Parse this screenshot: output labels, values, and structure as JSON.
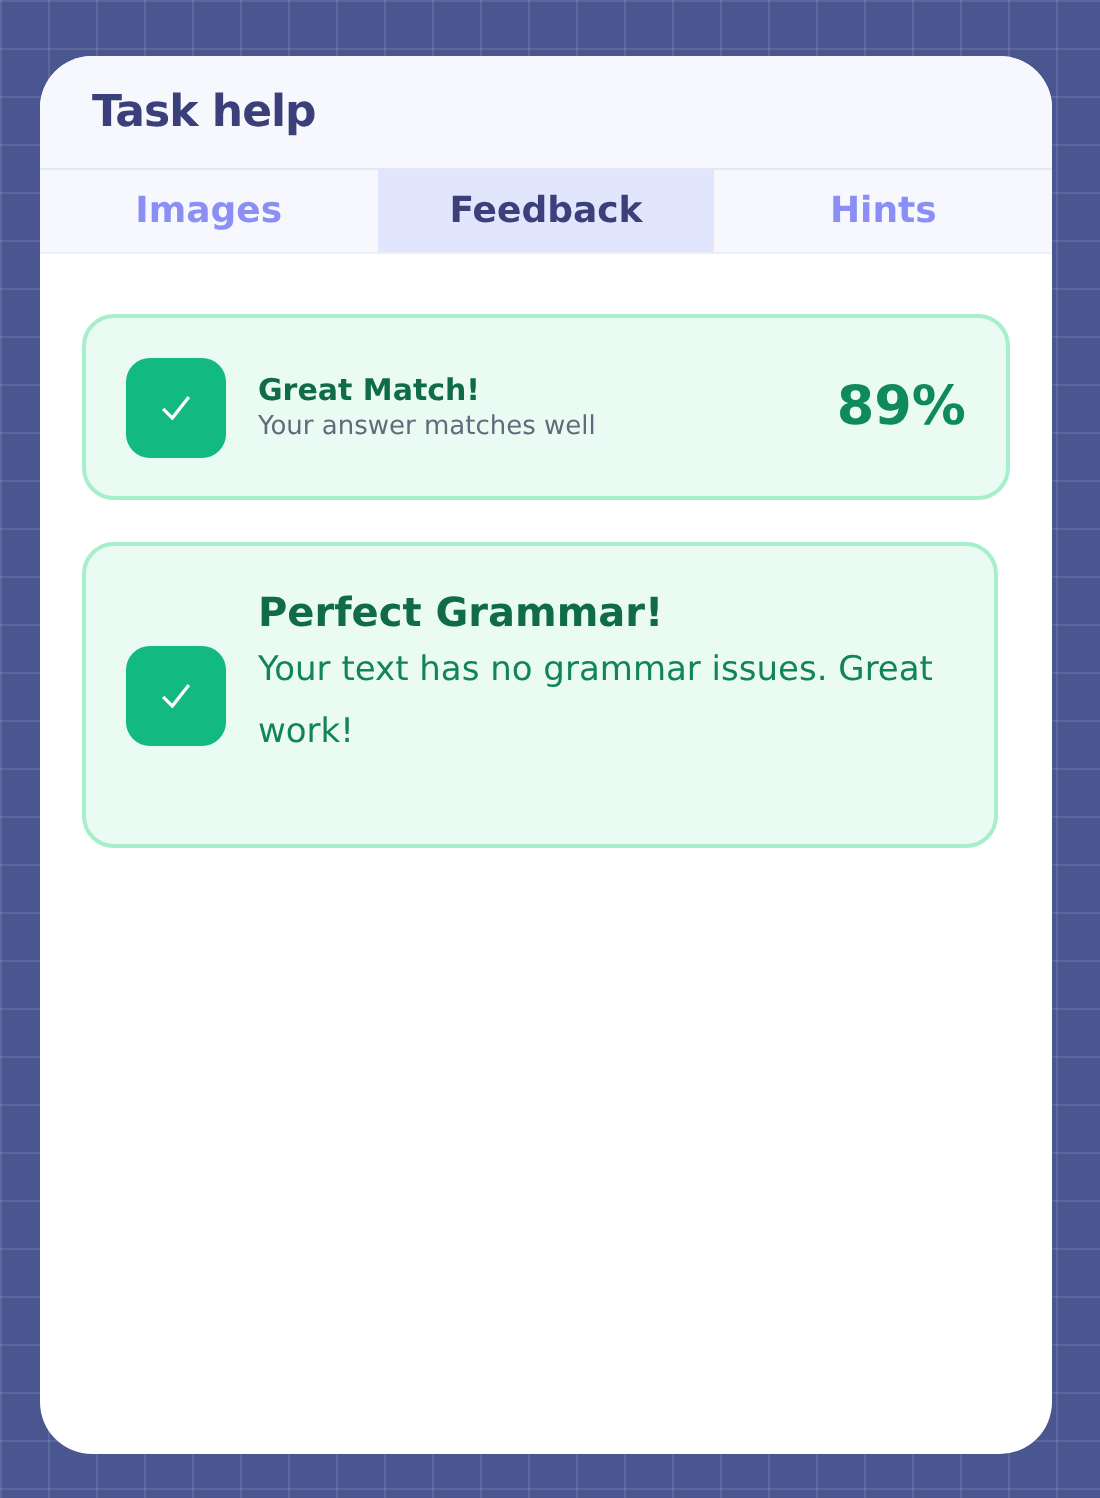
{
  "panel": {
    "title": "Task help"
  },
  "tabs": [
    {
      "label": "Images",
      "selected": false
    },
    {
      "label": "Feedback",
      "selected": true
    },
    {
      "label": "Hints",
      "selected": false
    }
  ],
  "feedback": [
    {
      "kind": "score",
      "title": "Great Match!",
      "text": "Your answer matches well",
      "score": "89%"
    },
    {
      "kind": "message",
      "title": "Perfect Grammar!",
      "text": "Your text has no grammar issues. Great work!"
    }
  ]
}
